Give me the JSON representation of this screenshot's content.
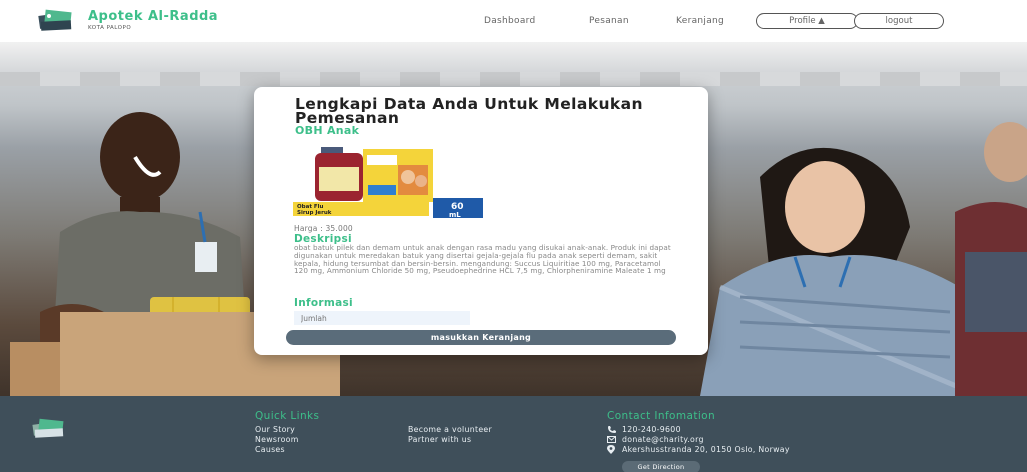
{
  "navbar": {
    "brand_name": "Apotek Al-Radda",
    "brand_sub": "KOTA PALOPO",
    "links": [
      "Dashboard",
      "Pesanan",
      "Keranjang"
    ],
    "profile_label": "Profile ▲",
    "logout_label": "logout"
  },
  "card": {
    "title": "Lengkapi Data Anda Untuk Melakukan Pemesanan",
    "product_name": "OBH Anak",
    "product_image": {
      "label_line1": "Obat Flu",
      "label_line2": "Sirup Jeruk",
      "volume": "60",
      "volume_unit": "mL"
    },
    "price": "Harga : 35.000",
    "description_title": "Deskripsi",
    "description": "obat batuk pilek dan demam untuk anak dengan rasa madu yang disukai anak-anak. Produk ini dapat digunakan untuk meredakan batuk yang disertai gejala-gejala flu pada anak seperti demam, sakit kepala, hidung tersumbat dan bersin-bersin. mengandung: Succus Liquiritiae 100 mg, Paracetamol 120 mg, Ammonium Chloride 50 mg, Pseudoephedrine HCL 7,5 mg, Chlorpheniramine Maleate 1 mg",
    "info_title": "Informasi",
    "quantity_placeholder": "Jumlah",
    "add_cart_label": "masukkan Keranjang"
  },
  "footer": {
    "quick_links_title": "Quick Links",
    "col1": [
      "Our Story",
      "Newsroom",
      "Causes"
    ],
    "col2": [
      "Become a volunteer",
      "Partner with us"
    ],
    "contact_title": "Contact Infomation",
    "phone": "120-240-9600",
    "email": "donate@charity.org",
    "address": "Akershusstranda 20, 0150 Oslo, Norway",
    "get_direction_label": "Get Direction"
  },
  "colors": {
    "accent": "#3dbf8a",
    "footer_bg": "#3f4f5a",
    "button_bg": "#5a6c7a"
  },
  "icons": [
    "hands-logo-icon",
    "phone-icon",
    "mail-icon",
    "location-pin-icon"
  ]
}
